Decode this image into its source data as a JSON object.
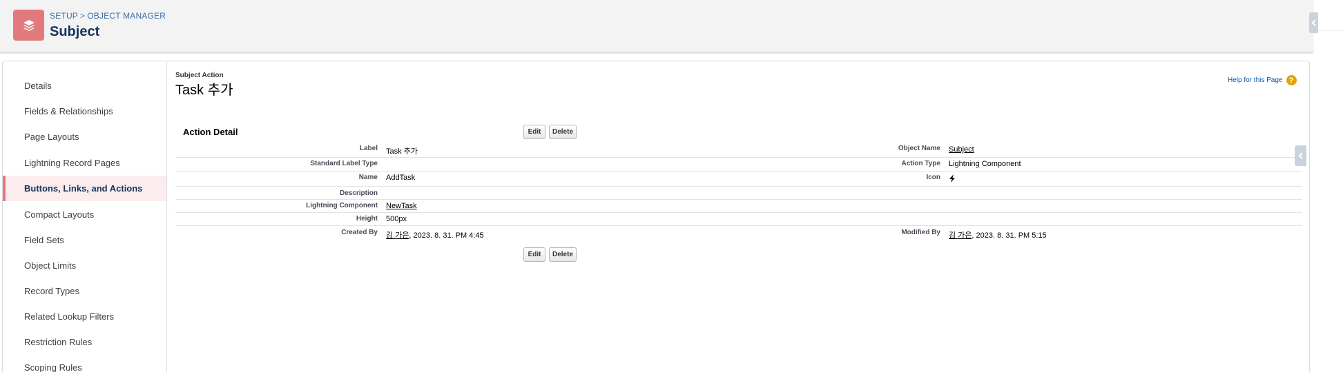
{
  "header": {
    "breadcrumb": [
      "SETUP",
      "OBJECT MANAGER"
    ],
    "breadcrumb_separator": ">",
    "title": "Subject",
    "icon": "stack-layers-icon",
    "icon_color": "#e27a7d"
  },
  "sidebar": {
    "items": [
      {
        "label": "Details"
      },
      {
        "label": "Fields & Relationships"
      },
      {
        "label": "Page Layouts"
      },
      {
        "label": "Lightning Record Pages"
      },
      {
        "label": "Buttons, Links, and Actions",
        "active": true
      },
      {
        "label": "Compact Layouts"
      },
      {
        "label": "Field Sets"
      },
      {
        "label": "Object Limits"
      },
      {
        "label": "Record Types"
      },
      {
        "label": "Related Lookup Filters"
      },
      {
        "label": "Restriction Rules"
      },
      {
        "label": "Scoping Rules"
      }
    ]
  },
  "content": {
    "type_label": "Subject Action",
    "title": "Task 추가",
    "help_link": "Help for this Page",
    "help_icon": "?",
    "section_title": "Action Detail",
    "buttons": {
      "edit": "Edit",
      "delete": "Delete"
    },
    "fields": {
      "label": {
        "label": "Label",
        "value": "Task 추가"
      },
      "object_name": {
        "label": "Object Name",
        "value": "Subject"
      },
      "standard_label_type": {
        "label": "Standard Label Type",
        "value": ""
      },
      "action_type": {
        "label": "Action Type",
        "value": "Lightning Component"
      },
      "name": {
        "label": "Name",
        "value": "AddTask"
      },
      "icon": {
        "label": "Icon",
        "value_icon": "lightning-bolt-icon"
      },
      "description": {
        "label": "Description",
        "value": ""
      },
      "lightning_component": {
        "label": "Lightning Component",
        "value": "NewTask"
      },
      "height": {
        "label": "Height",
        "value": "500px"
      },
      "created_by": {
        "label": "Created By",
        "user": "김 가은",
        "date": ", 2023. 8. 31. PM 4:45"
      },
      "modified_by": {
        "label": "Modified By",
        "user": "김 가은",
        "date": ", 2023. 8. 31. PM 5:15"
      }
    }
  },
  "colors": {
    "accent": "#e27a7d",
    "active_bg": "#fbeced",
    "link": "#3a6fa5",
    "help": "#e6a200"
  }
}
